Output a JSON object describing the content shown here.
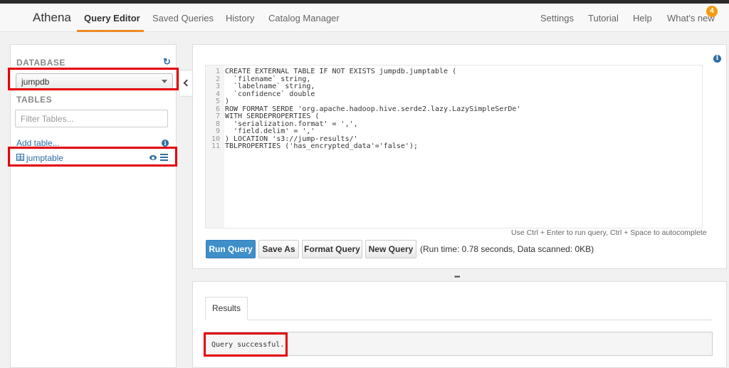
{
  "nav": {
    "brand": "Athena",
    "items": [
      "Query Editor",
      "Saved Queries",
      "History",
      "Catalog Manager"
    ],
    "right_items": [
      "Settings",
      "Tutorial",
      "Help",
      "What's new"
    ],
    "whats_new_badge": "4"
  },
  "sidebar": {
    "database_label": "DATABASE",
    "database_selected": "jumpdb",
    "tables_label": "TABLES",
    "filter_placeholder": "Filter Tables...",
    "add_table": "Add table...",
    "tables": [
      {
        "name": "jumptable"
      }
    ]
  },
  "editor": {
    "lines": [
      {
        "n": "1",
        "text": "CREATE EXTERNAL TABLE IF NOT EXISTS jumpdb.jumptable ("
      },
      {
        "n": "2",
        "text": "  `filename` string,"
      },
      {
        "n": "3",
        "text": "  `labelname` string,"
      },
      {
        "n": "4",
        "text": "  `confidence` double"
      },
      {
        "n": "5",
        "text": ")"
      },
      {
        "n": "6",
        "text": "ROW FORMAT SERDE 'org.apache.hadoop.hive.serde2.lazy.LazySimpleSerDe'"
      },
      {
        "n": "7",
        "text": "WITH SERDEPROPERTIES ("
      },
      {
        "n": "8",
        "text": "  'serialization.format' = ',',"
      },
      {
        "n": "9",
        "text": "  'field.delim' = ','"
      },
      {
        "n": "10",
        "text": ") LOCATION 's3://jump-results/'"
      },
      {
        "n": "11",
        "text": "TBLPROPERTIES ('has_encrypted_data'='false');"
      }
    ],
    "hint": "Use Ctrl + Enter to run query, Ctrl + Space to autocomplete",
    "buttons": {
      "run": "Run Query",
      "save_as": "Save As",
      "format": "Format Query",
      "new": "New Query"
    },
    "run_info": "(Run time: 0.78 seconds, Data scanned: 0KB)"
  },
  "results": {
    "tab": "Results",
    "status": "Query successful."
  },
  "colors": {
    "accent": "#f08a24",
    "link": "#2e6da4",
    "primary_button": "#3f8fc9",
    "highlight_box": "#e3000b"
  }
}
